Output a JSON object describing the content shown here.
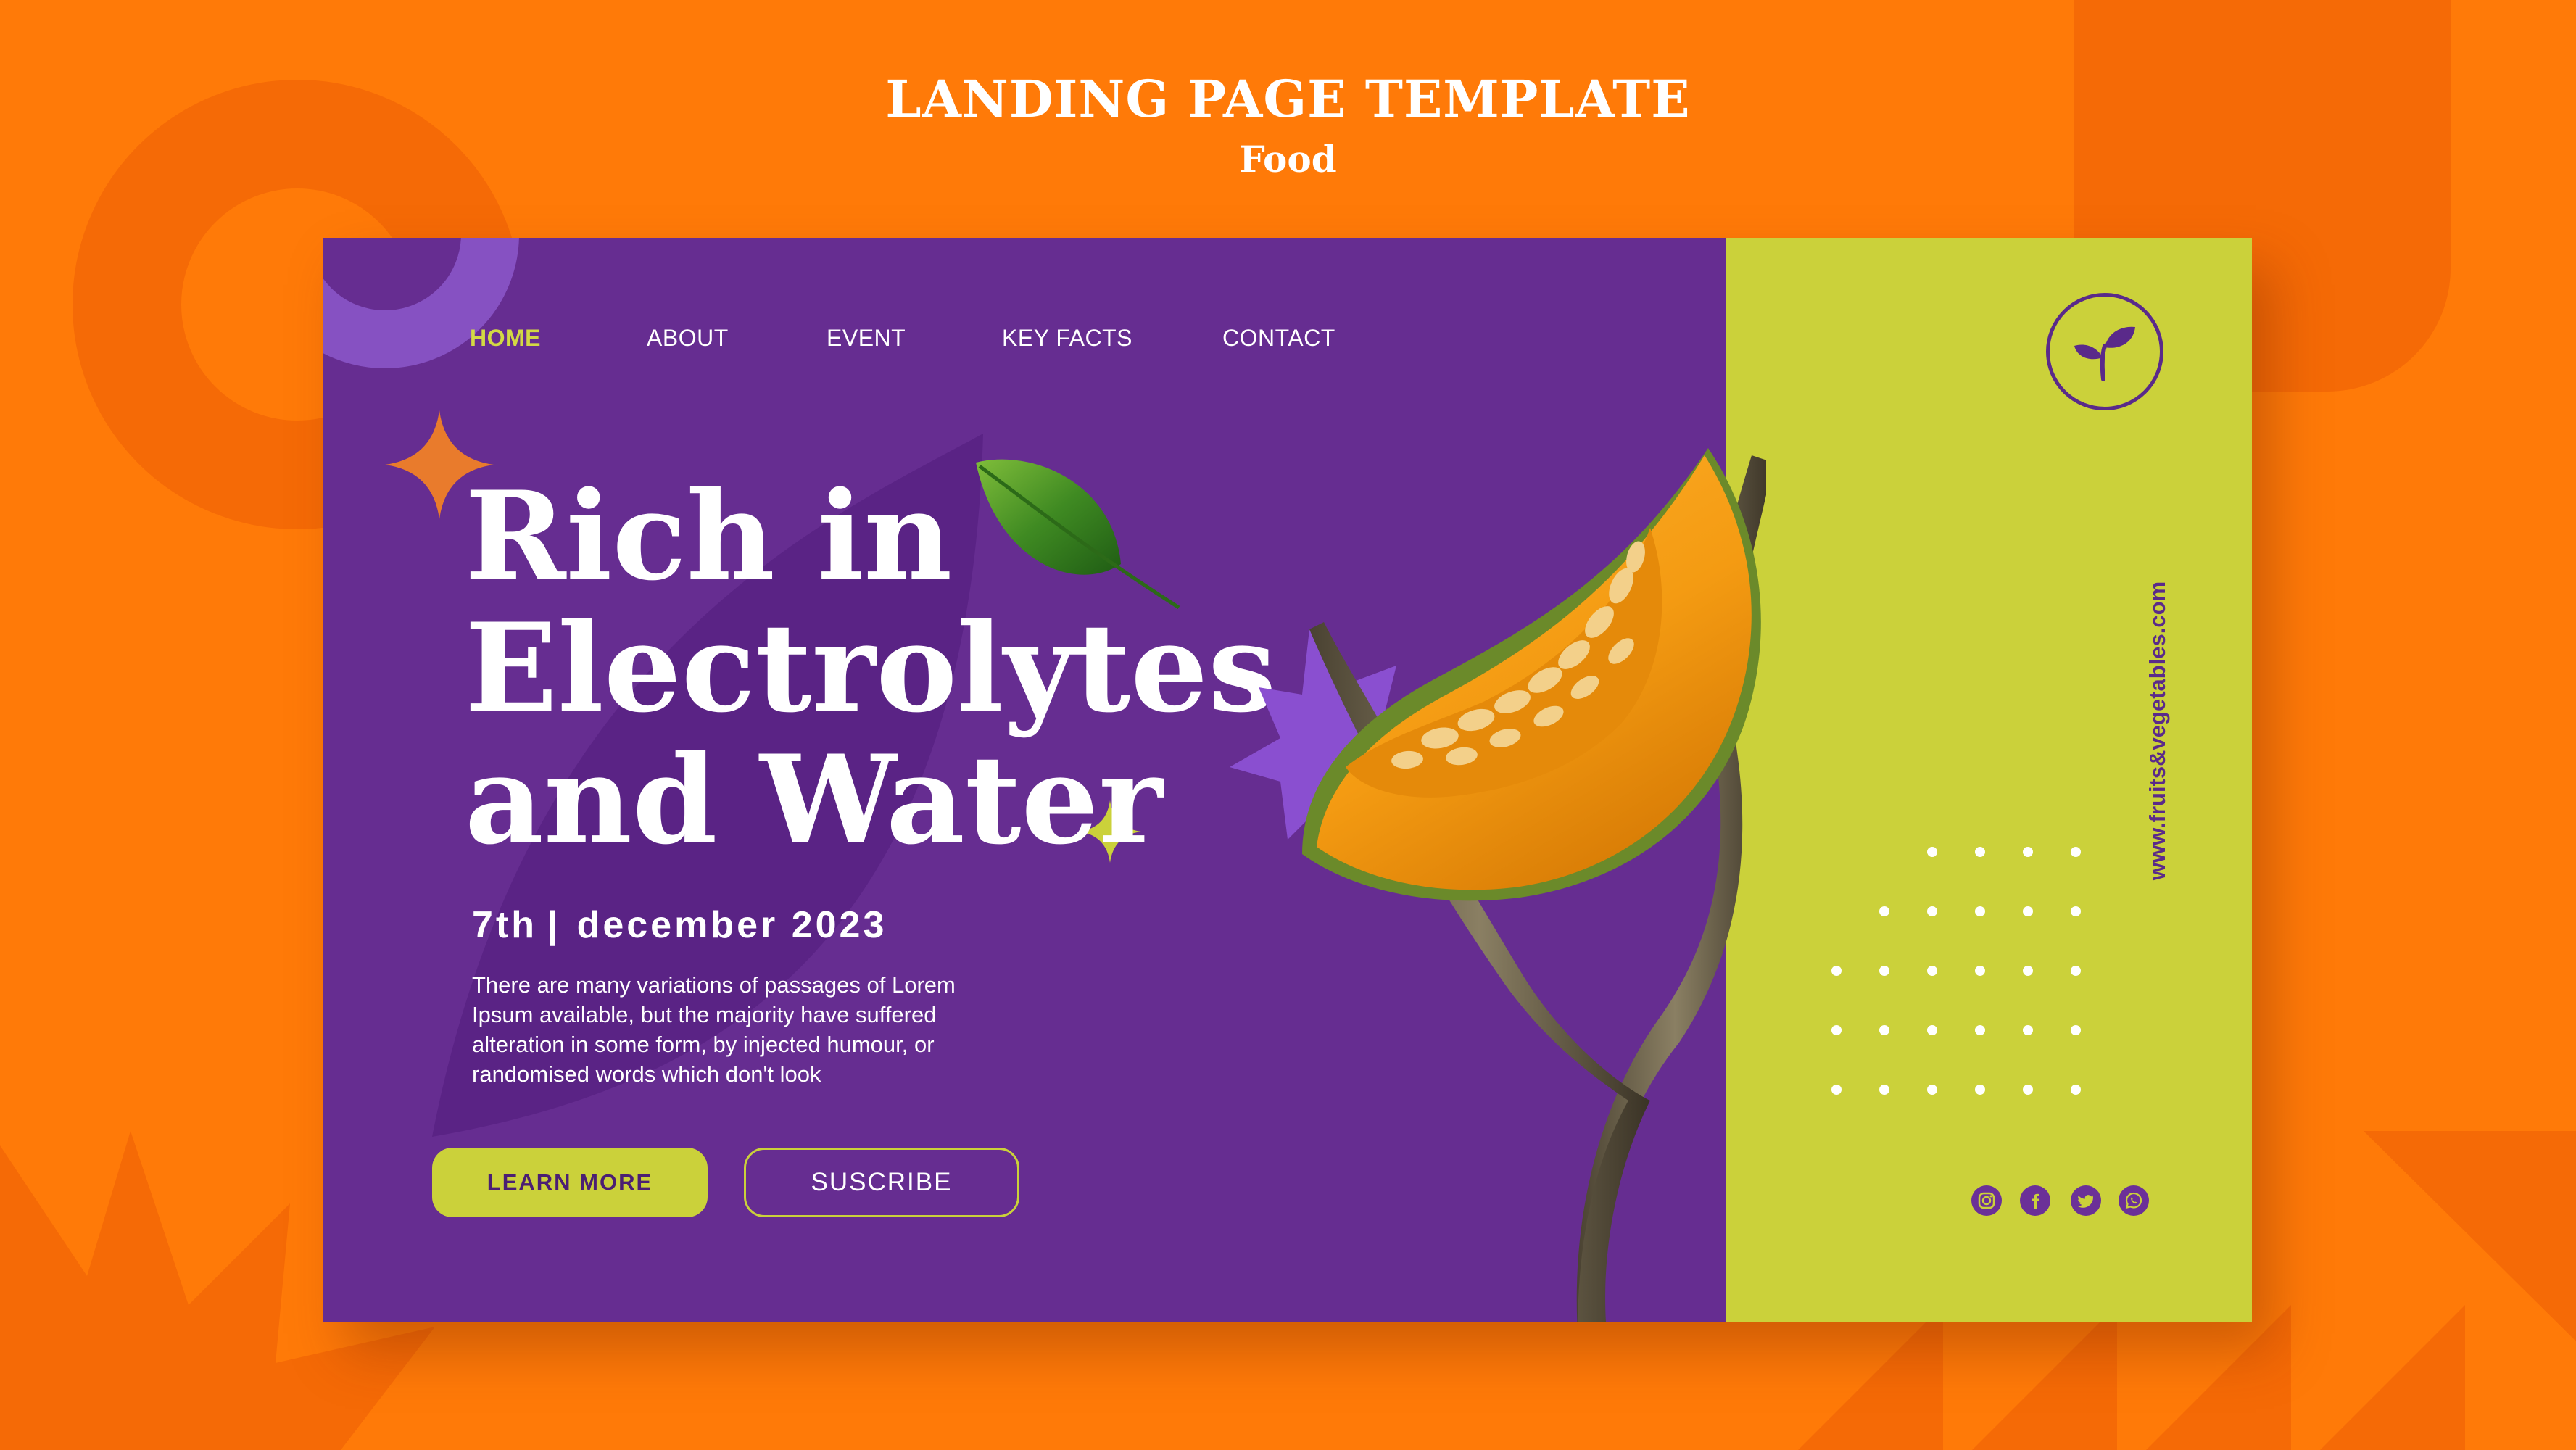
{
  "header": {
    "title": "LANDING PAGE TEMPLATE",
    "subtitle": "Food"
  },
  "nav": {
    "items": [
      {
        "label": "HOME",
        "active": true
      },
      {
        "label": "ABOUT",
        "active": false
      },
      {
        "label": "EVENT",
        "active": false
      },
      {
        "label": "KEY FACTS",
        "active": false
      },
      {
        "label": "CONTACT",
        "active": false
      }
    ]
  },
  "hero": {
    "headline": [
      "Rich in",
      "Electrolytes",
      "and Water"
    ],
    "date_day": "7th",
    "date_separator": "|",
    "date_rest": "december 2023",
    "body": "There are many variations of passages of Lorem Ipsum available, but the majority have suffered alteration in some form, by injected humour, or randomised words which don't look",
    "learn_more_label": "LEARN MORE",
    "subscribe_label": "SUSCRIBE"
  },
  "side": {
    "url": "www.fruits&vegetables.com",
    "logo_icon": "sprout-icon",
    "social_icons": [
      "instagram-icon",
      "facebook-icon",
      "twitter-icon",
      "whatsapp-icon"
    ]
  },
  "colors": {
    "background": "#ff7a08",
    "purple": "#662d91",
    "lime": "#cbd13a",
    "active_nav": "#d3d943",
    "sparkle_orange": "#e97b2c"
  }
}
